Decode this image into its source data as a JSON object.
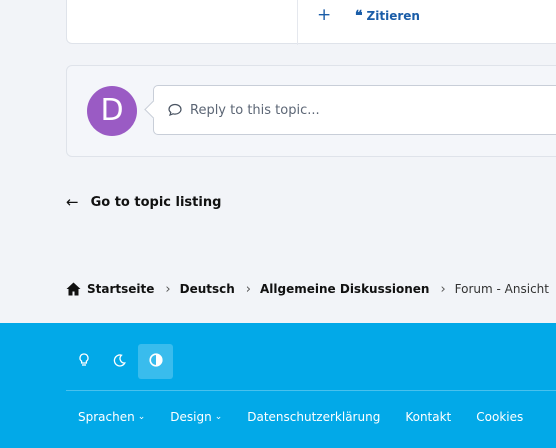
{
  "post": {
    "add_label": "+",
    "quote_icon": "quote-icon",
    "quote_label": "Zitieren"
  },
  "reply": {
    "avatar_letter": "D",
    "avatar_color": "#9a5bc4",
    "placeholder": "Reply to this topic..."
  },
  "back_link": {
    "icon": "arrow-left-icon",
    "label": "Go to topic listing"
  },
  "breadcrumb": {
    "items": [
      "Startseite",
      "Deutsch",
      "Allgemeine Diskussionen",
      "Forum - Ansicht"
    ]
  },
  "footer": {
    "background": "#02a9e8",
    "theme_buttons": [
      "lightbulb-icon",
      "moon-icon",
      "contrast-icon"
    ],
    "links": [
      {
        "label": "Sprachen",
        "dropdown": true
      },
      {
        "label": "Design",
        "dropdown": true
      },
      {
        "label": "Datenschutzerklärung",
        "dropdown": false
      },
      {
        "label": "Kontakt",
        "dropdown": false
      },
      {
        "label": "Cookies",
        "dropdown": false
      }
    ]
  }
}
